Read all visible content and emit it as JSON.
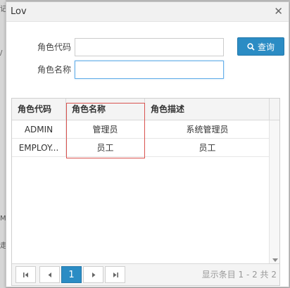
{
  "background": {
    "marks": [
      "记",
      "/",
      "M",
      "走"
    ]
  },
  "dialog": {
    "title": "Lov",
    "close_icon": "close-icon"
  },
  "form": {
    "role_code_label": "角色代码",
    "role_code_value": "",
    "role_name_label": "角色名称",
    "role_name_value": "",
    "query_button_label": "查询",
    "query_icon": "search-icon"
  },
  "grid": {
    "columns": [
      "角色代码",
      "角色名称",
      "角色描述"
    ],
    "rows": [
      {
        "code": "ADMIN",
        "name": "管理员",
        "description": "系统管理员"
      },
      {
        "code": "EMPLOY...",
        "name": "员工",
        "description": "员工"
      }
    ],
    "highlight_color": "#d9534f"
  },
  "pager": {
    "current_page": "1",
    "info": "显示条目 1 - 2 共 2"
  },
  "colors": {
    "accent": "#2b8cc4"
  }
}
